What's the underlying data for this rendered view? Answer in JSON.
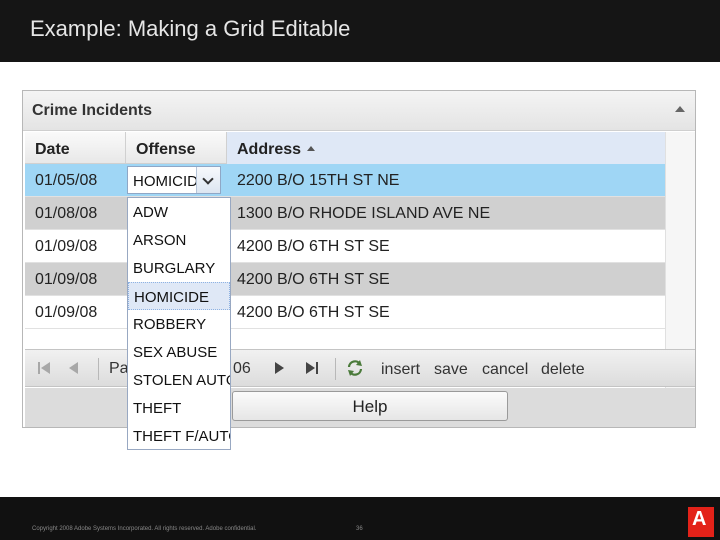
{
  "slide": {
    "title": "Example: Making a Grid Editable",
    "copyright": "Copyright 2008 Adobe Systems Incorporated. All rights reserved. Adobe confidential.",
    "page_number": "36",
    "logo_text": "A"
  },
  "panel": {
    "title": "Crime Incidents",
    "collapse_icon": "collapse-up-icon"
  },
  "grid": {
    "columns": [
      "Date",
      "Offense",
      "Address"
    ],
    "sorted_column": "Address",
    "sort_direction": "ascending",
    "rows": [
      {
        "date": "01/05/08",
        "offense": "HOMICIDE",
        "address": "2200 B/O 15TH ST NE"
      },
      {
        "date": "01/08/08",
        "offense": "",
        "address": "1300 B/O RHODE ISLAND AVE NE"
      },
      {
        "date": "01/09/08",
        "offense": "",
        "address": "4200 B/O 6TH ST SE"
      },
      {
        "date": "01/09/08",
        "offense": "",
        "address": "4200 B/O 6TH ST SE"
      },
      {
        "date": "01/09/08",
        "offense": "",
        "address": "4200 B/O 6TH ST SE"
      }
    ],
    "editor_value": "HOMICIDE"
  },
  "dropdown": {
    "options": [
      "ADW",
      "ARSON",
      "BURGLARY",
      "HOMICIDE",
      "ROBBERY",
      "SEX ABUSE",
      "STOLEN AUTO",
      "THEFT",
      "THEFT F/AUTO"
    ],
    "highlighted": "HOMICIDE"
  },
  "toolbar": {
    "page_label": "Pa",
    "page_suffix": "06",
    "insert_label": "insert",
    "save_label": "save",
    "cancel_label": "cancel",
    "delete_label": "delete"
  },
  "help_label": "Help"
}
